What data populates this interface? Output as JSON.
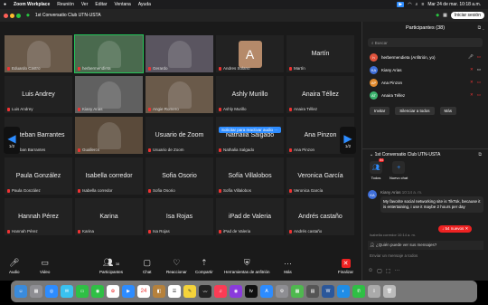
{
  "menubar": {
    "app": "Zoom Workplace",
    "items": [
      "Reunión",
      "Ver",
      "Editar",
      "Ventana",
      "Ayuda"
    ],
    "datetime": "Mar 24 de mar. 10:18 a.m."
  },
  "titlebar": {
    "title": "1st Conversatio Club UTN-USTA",
    "start_button": "Iniciar sesión"
  },
  "grid": {
    "page_left": "1/2",
    "page_right": "1/2",
    "request_audio": "Solicitar para reactivar audio",
    "tiles": [
      {
        "name": "",
        "caption": "Eduardo Castro",
        "video": true
      },
      {
        "name": "",
        "caption": "herbermendieta",
        "video": true,
        "active": true
      },
      {
        "name": "",
        "caption": "Gerardo",
        "video": true
      },
      {
        "name": "A",
        "caption": "Andres Solano",
        "avatar": true
      },
      {
        "name": "Martín",
        "caption": "Martín"
      },
      {
        "name": "Luis Andrey",
        "caption": "Luis Andrey"
      },
      {
        "name": "",
        "caption": "Kiany Arias",
        "video": true
      },
      {
        "name": "",
        "caption": "Angie Romero",
        "video": true
      },
      {
        "name": "Ashly Murillo",
        "caption": "Ashly Murillo"
      },
      {
        "name": "Anaira Téllez",
        "caption": "Anaira Téllez"
      },
      {
        "name": "Esteban Barrantes",
        "caption": "Esteban Barrantes"
      },
      {
        "name": "",
        "caption": "Guallercs",
        "video": true
      },
      {
        "name": "Usuario de Zoom",
        "caption": "Usuario de Zoom"
      },
      {
        "name": "Nathalia Salgado",
        "caption": "Nathalia Salgado"
      },
      {
        "name": "Ana Pinzon",
        "caption": "Ana Pinzon"
      },
      {
        "name": "Paula González",
        "caption": "Paula González"
      },
      {
        "name": "Isabella corredor",
        "caption": "Isabella corredor"
      },
      {
        "name": "Sofia Osorio",
        "caption": "Sofia Osorio"
      },
      {
        "name": "Sofía Villalobos",
        "caption": "Sofía Villalobos"
      },
      {
        "name": "Veronica García",
        "caption": "Veronica García"
      },
      {
        "name": "Hannah Pérez",
        "caption": "Hannah Pérez"
      },
      {
        "name": "Karina",
        "caption": "Karina"
      },
      {
        "name": "Isa Rojas",
        "caption": "Isa Rojas"
      },
      {
        "name": "iPad de Valeria",
        "caption": "iPad de Valeria"
      },
      {
        "name": "Andrés castaño",
        "caption": "Andrés castaño"
      }
    ]
  },
  "toolbar": {
    "audio": "Audio",
    "video": "Video",
    "participants": "Participantes",
    "participants_count": "38",
    "chat": "Chat",
    "react": "Reaccionar",
    "share": "Compartir",
    "whiteboard": "Herramientas de anfitrión",
    "more": "Más",
    "end": "Finalizar"
  },
  "participants_panel": {
    "title": "Participantes (38)",
    "search_placeholder": "Buscar",
    "list": [
      {
        "initials": "h",
        "name": "herbermendieta (Anfitrión, yo)",
        "color": "#e0543d"
      },
      {
        "initials": "KA",
        "name": "Kiany Arias",
        "color": "#3f6fd9"
      },
      {
        "initials": "AP",
        "name": "Ana Pinzon",
        "color": "#e08a2e"
      },
      {
        "initials": "AT",
        "name": "Anaira Téllez",
        "color": "#3cb36e"
      }
    ],
    "invite": "Invitar",
    "mute_all": "Silenciar a todos",
    "more": "Más"
  },
  "chat_panel": {
    "title": "1st Conversatio Club UTN-USTA",
    "tab_all": "Todos",
    "tab_all_badge": "54",
    "tab_new": "Nuevo chat",
    "message_initials": "KA",
    "message_sender": "Kiany Arias",
    "message_time": "10:14 a. m.",
    "message_text": "My favorite social networking site is TikTok, because it is entertaining, i use it maybe 2 hours per day",
    "next_sender": "Isabella corredor",
    "next_time": "10:14 a. m.",
    "new_badge": "54 nuevos",
    "who_can_see": "¿Quién puede ver sus mensajes?",
    "input_placeholder": "Enviar un mensaje a todos"
  },
  "dock_date": "24"
}
